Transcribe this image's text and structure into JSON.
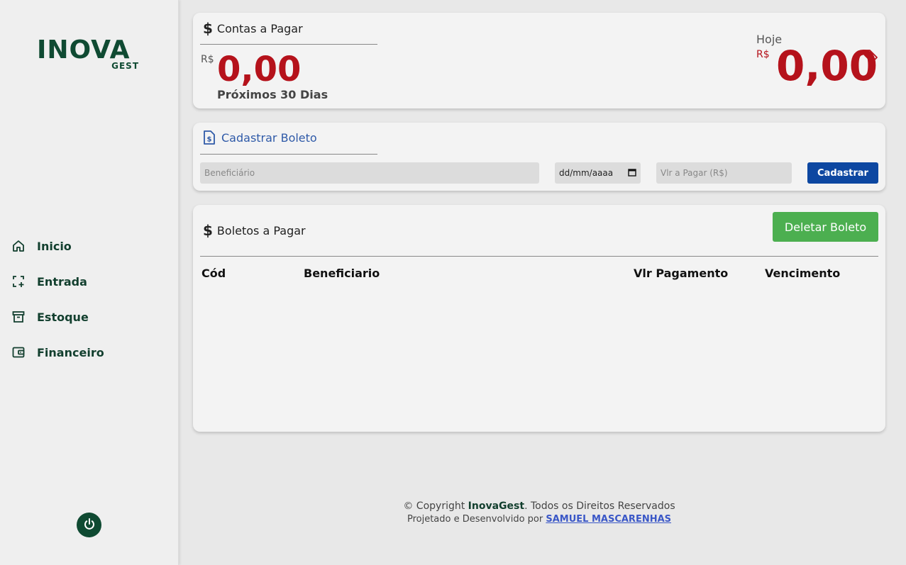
{
  "brand": {
    "logo_main": "INOVA",
    "logo_sub": "GEST",
    "color_primary": "#0f4a32"
  },
  "sidebar": {
    "items": [
      {
        "label": "Inicio",
        "icon": "home-icon"
      },
      {
        "label": "Entrada",
        "icon": "entry-icon"
      },
      {
        "label": "Estoque",
        "icon": "archive-icon"
      },
      {
        "label": "Financeiro",
        "icon": "wallet-icon"
      }
    ],
    "power_icon": "power-icon"
  },
  "summary": {
    "title": "Contas a Pagar",
    "currency": "R$",
    "value": "0,00",
    "period_label": "Próximos 30 Dias",
    "today_label": "Hoje",
    "today_currency": "R$",
    "today_value": "0,00",
    "value_color": "#b5121b"
  },
  "register": {
    "title": "Cadastrar Boleto",
    "beneficiary_placeholder": "Beneficiário",
    "date_placeholder": "dd/mm/aaaa",
    "amount_placeholder": "Vlr a Pagar (R$)",
    "submit_label": "Cadastrar"
  },
  "list": {
    "title": "Boletos a Pagar",
    "delete_label": "Deletar Boleto",
    "columns": [
      "Cód",
      "Beneficiario",
      "Vlr Pagamento",
      "Vencimento"
    ]
  },
  "footer": {
    "copyright_prefix": "© Copyright",
    "brand": "InovaGest",
    "copyright_suffix": ". Todos os Direitos Reservados",
    "credits_prefix": "Projetado e Desenvolvido por",
    "author": "SAMUEL MASCARENHAS"
  }
}
